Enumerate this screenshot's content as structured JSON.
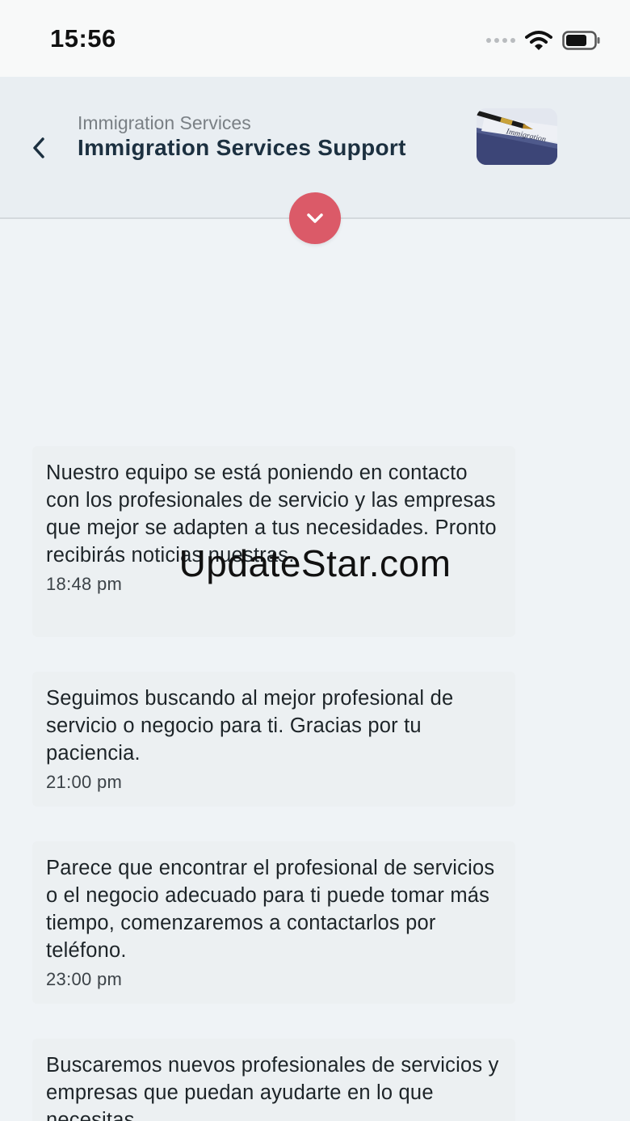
{
  "status_bar": {
    "time": "15:56",
    "icons": [
      "cellular-signal-icon",
      "wifi-icon",
      "battery-icon"
    ]
  },
  "header": {
    "subtitle": "Immigration Services",
    "title": "Immigration Services Support",
    "back_icon": "chevron-left-icon",
    "avatar_text": "Immigration"
  },
  "scroll_button": {
    "icon": "chevron-down-icon",
    "color": "#db5a68"
  },
  "messages": [
    {
      "text": "Nuestro equipo se está poniendo en contacto con los profesionales de servicio y las empresas que mejor se adapten a tus necesidades. Pronto recibirás noticias nuestras.",
      "time": "18:48 pm"
    },
    {
      "text": "Seguimos buscando al mejor profesional de servicio o negocio para ti. Gracias por tu paciencia.",
      "time": "21:00 pm"
    },
    {
      "text": "Parece que encontrar el profesional de servicios o el negocio adecuado para ti puede tomar más tiempo, comenzaremos a contactarlos por teléfono.",
      "time": "23:00 pm"
    },
    {
      "text": "Buscaremos nuevos profesionales de servicios y empresas que puedan ayudarte en lo que necesitas.",
      "time": ""
    }
  ],
  "watermark": "UpdateStar.com",
  "colors": {
    "background": "#eff3f6",
    "header": "#e9eef2",
    "title": "#1c3040",
    "accent": "#db5a68"
  }
}
